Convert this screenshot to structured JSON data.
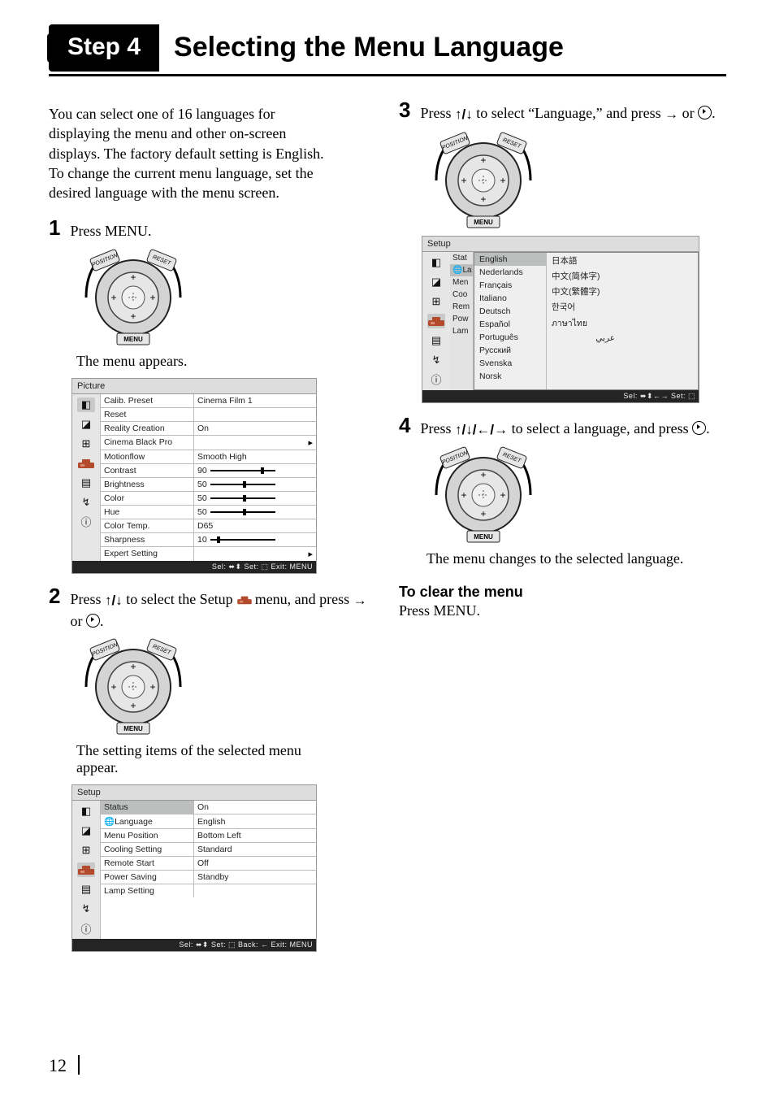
{
  "page_number": "12",
  "header": {
    "step_badge": "Step 4",
    "title": "Selecting the Menu Language"
  },
  "intro": "You can select one of 16 languages for displaying the menu and other on-screen displays. The factory default setting is English. To change the current menu language, set the desired language with the menu screen.",
  "dpad_labels": {
    "top_left": "POSITION",
    "top_right": "RESET",
    "bottom": "MENU"
  },
  "steps": {
    "s1": {
      "num": "1",
      "text": "Press MENU.",
      "caption": "The menu appears."
    },
    "s2": {
      "num": "2",
      "pre": "Press ",
      "mid": " to select the Setup ",
      "post": " menu, and press ",
      "or": " or ",
      "tail": ".",
      "caption": "The setting items of the selected menu appear."
    },
    "s3": {
      "num": "3",
      "pre": "Press ",
      "mid": " to select “Language,” and press ",
      "or": " or ",
      "tail": "."
    },
    "s4": {
      "num": "4",
      "pre": "Press ",
      "mid": " to select a language, and press ",
      "tail": ".",
      "caption": "The menu changes to the selected language."
    }
  },
  "clear": {
    "heading": "To clear the menu",
    "text": "Press MENU."
  },
  "glyphs": {
    "updown": "↑/↓",
    "fourway": "↑/↓/←/→",
    "right": "→"
  },
  "osd_picture": {
    "title": "Picture",
    "rows": [
      {
        "l": "Calib. Preset",
        "r": "Cinema Film 1"
      },
      {
        "l": "Reset",
        "r": ""
      },
      {
        "l": "Reality Creation",
        "r": "On"
      },
      {
        "l": "Cinema Black Pro",
        "r": "",
        "arrow": true
      },
      {
        "l": "Motionflow",
        "r": "Smooth High"
      },
      {
        "l": "Contrast",
        "r": "90",
        "slider": 0.78
      },
      {
        "l": "Brightness",
        "r": "50",
        "slider": 0.5
      },
      {
        "l": "Color",
        "r": "50",
        "slider": 0.5
      },
      {
        "l": "Hue",
        "r": "50",
        "slider": 0.5
      },
      {
        "l": "Color Temp.",
        "r": "D65"
      },
      {
        "l": "Sharpness",
        "r": "10",
        "slider": 0.1
      },
      {
        "l": "Expert Setting",
        "r": "",
        "arrow": true
      }
    ],
    "footer": "Sel: ⬌⬍   Set: ⬚   Exit: MENU"
  },
  "osd_setup": {
    "title": "Setup",
    "rows": [
      {
        "l": "Status",
        "r": "On",
        "sel": true
      },
      {
        "l": "🌐Language",
        "r": "English"
      },
      {
        "l": "Menu Position",
        "r": "Bottom Left"
      },
      {
        "l": "Cooling Setting",
        "r": "Standard"
      },
      {
        "l": "Remote Start",
        "r": "Off"
      },
      {
        "l": "Power Saving",
        "r": "Standby"
      },
      {
        "l": "Lamp Setting",
        "r": ""
      }
    ],
    "footer": "Sel: ⬌⬍   Set: ⬚   Back: ←   Exit: MENU"
  },
  "osd_lang": {
    "title": "Setup",
    "trunc_rows": [
      "Stat",
      "🌐La",
      "Men",
      "Coo",
      "Rem",
      "Pow",
      "Lam"
    ],
    "col1": [
      "English",
      "Nederlands",
      "Français",
      "Italiano",
      "Deutsch",
      "Español",
      "Português",
      "Русский",
      "Svenska",
      "Norsk"
    ],
    "col2": [
      "日本語",
      "中文(简体字)",
      "中文(繁體字)",
      "한국어",
      "ภาษาไทย",
      "عربي"
    ],
    "footer": "Sel: ⬌⬍←→   Set: ⬚"
  }
}
